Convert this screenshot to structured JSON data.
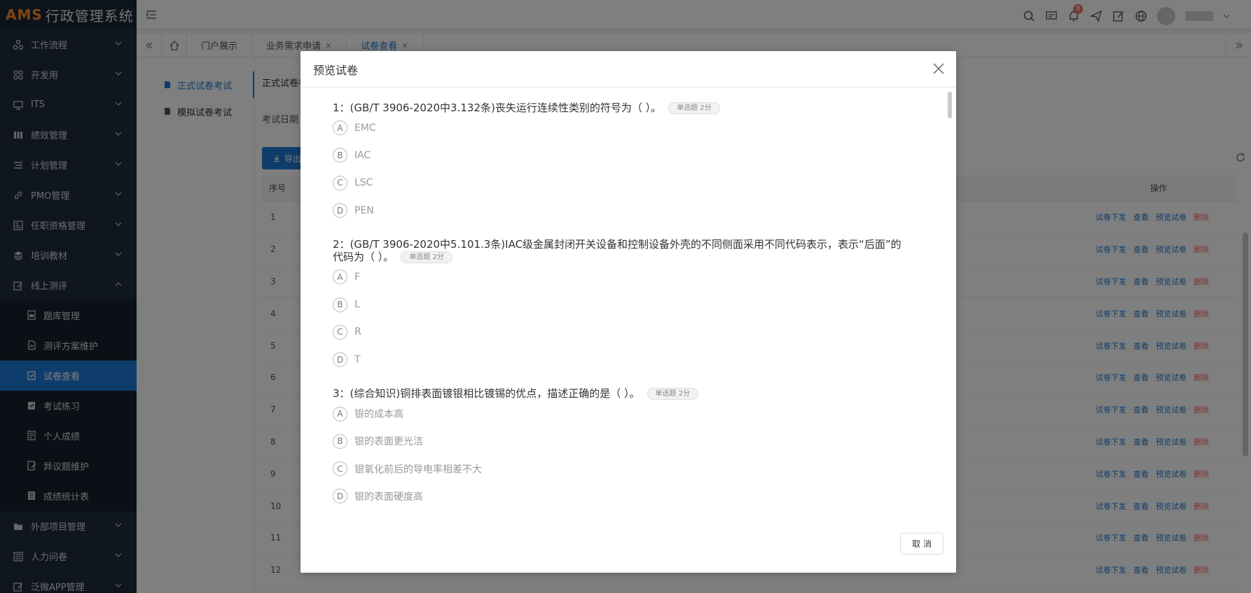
{
  "app": {
    "logo_prefix": "AMS",
    "logo_name": "行政管理系统"
  },
  "topbar": {
    "notification_count": "8"
  },
  "sidebar": {
    "items": [
      {
        "label": "工作流程",
        "icon": "workflow-icon"
      },
      {
        "label": "开发用",
        "icon": "grid-icon"
      },
      {
        "label": "ITS",
        "icon": "monitor-icon"
      },
      {
        "label": "绩效管理",
        "icon": "columns-icon"
      },
      {
        "label": "计划管理",
        "icon": "list-icon"
      },
      {
        "label": "PMO管理",
        "icon": "link-icon"
      },
      {
        "label": "任职资格管理",
        "icon": "id-card-icon"
      },
      {
        "label": "培训教材",
        "icon": "layers-icon"
      },
      {
        "label": "线上测评",
        "icon": "edit-icon"
      }
    ],
    "sub_items": [
      {
        "label": "题库管理"
      },
      {
        "label": "测评方案维护"
      },
      {
        "label": "试卷查看"
      },
      {
        "label": "考试练习"
      },
      {
        "label": "个人成绩"
      },
      {
        "label": "异议题维护"
      },
      {
        "label": "成绩统计表"
      }
    ],
    "bottom_items": [
      {
        "label": "外部项目管理",
        "icon": "folder-icon"
      },
      {
        "label": "人力问卷",
        "icon": "form-icon"
      },
      {
        "label": "泛微APP管理",
        "icon": "app-edit-icon"
      }
    ]
  },
  "tabs": [
    {
      "label": "门户展示"
    },
    {
      "label": "业务需求申请"
    },
    {
      "label": "试卷查看"
    }
  ],
  "left_menu": {
    "formal": "正式试卷考试",
    "mock": "模拟试卷考试"
  },
  "main": {
    "crumb_tab": "正式试卷考",
    "date_label": "考试日期",
    "export_label": "导出",
    "col_index": "序号",
    "col_ops": "操作",
    "rows": [
      "1",
      "2",
      "3",
      "4",
      "5",
      "6",
      "7",
      "8",
      "9",
      "10",
      "11",
      "12"
    ],
    "action_dispatch": "试卷下发",
    "action_view": "查看",
    "action_preview": "预览试卷",
    "action_delete": "删除"
  },
  "modal": {
    "title": "预览试卷",
    "cancel_label": "取 消",
    "questions": [
      {
        "title": "1：(GB/T 3906-2020中3.132条)丧失运行连续性类别的符号为（ ）。",
        "tag": "单选题 2分",
        "options": [
          {
            "letter": "A",
            "text": "EMC"
          },
          {
            "letter": "B",
            "text": "IAC"
          },
          {
            "letter": "C",
            "text": "LSC"
          },
          {
            "letter": "D",
            "text": "PEN"
          }
        ]
      },
      {
        "title": "2：(GB/T 3906-2020中5.101.3条)IAC级金属封闭开关设备和控制设备外壳的不同侧面采用不同代码表示，表示“后面”的代码为（ ）。",
        "tag": "单选题 2分",
        "options": [
          {
            "letter": "A",
            "text": "F"
          },
          {
            "letter": "B",
            "text": "L"
          },
          {
            "letter": "C",
            "text": "R"
          },
          {
            "letter": "D",
            "text": "T"
          }
        ]
      },
      {
        "title": "3：(综合知识)铜排表面镀银相比镀锡的优点，描述正确的是（ ）。",
        "tag": "单选题 2分",
        "options": [
          {
            "letter": "A",
            "text": "银的成本高"
          },
          {
            "letter": "B",
            "text": "银的表面更光洁"
          },
          {
            "letter": "C",
            "text": "银氧化前后的导电率相差不大"
          },
          {
            "letter": "D",
            "text": "银的表面硬度高"
          }
        ]
      }
    ]
  },
  "colors": {
    "primary": "#1f7bd6",
    "danger": "#f56c6c",
    "sidebar_bg": "#1f2d3d",
    "logo_accent": "#ff8a1f"
  }
}
